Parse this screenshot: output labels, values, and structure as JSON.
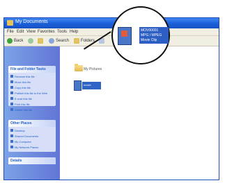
{
  "window": {
    "title": "My Documents"
  },
  "menubar": {
    "items": [
      "File",
      "Edit",
      "View",
      "Favorites",
      "Tools",
      "Help"
    ]
  },
  "toolbar": {
    "back_label": "Back",
    "search_label": "Search",
    "folders_label": "Folders"
  },
  "sidebar": {
    "tasks_panel": {
      "title": "File and Folder Tasks",
      "items": [
        "Rename this file",
        "Move this file",
        "Copy this file",
        "Publish this file to the Web",
        "E-mail this file",
        "Print this file",
        "Delete this file"
      ]
    },
    "places_panel": {
      "title": "Other Places",
      "items": [
        "Desktop",
        "Shared Documents",
        "My Computer",
        "My Network Places"
      ]
    },
    "details_panel": {
      "title": "Details"
    }
  },
  "content": {
    "folder_name": "My Pictures",
    "file_name": "movie",
    "zoom_callout": {
      "lines": [
        "MOV00001",
        "MPG / MPEG",
        "Movie Clip"
      ]
    }
  },
  "colors": {
    "titlebar": "#1b5fd8",
    "sidebar": "#6f8ddf",
    "selection": "#3165c5"
  }
}
